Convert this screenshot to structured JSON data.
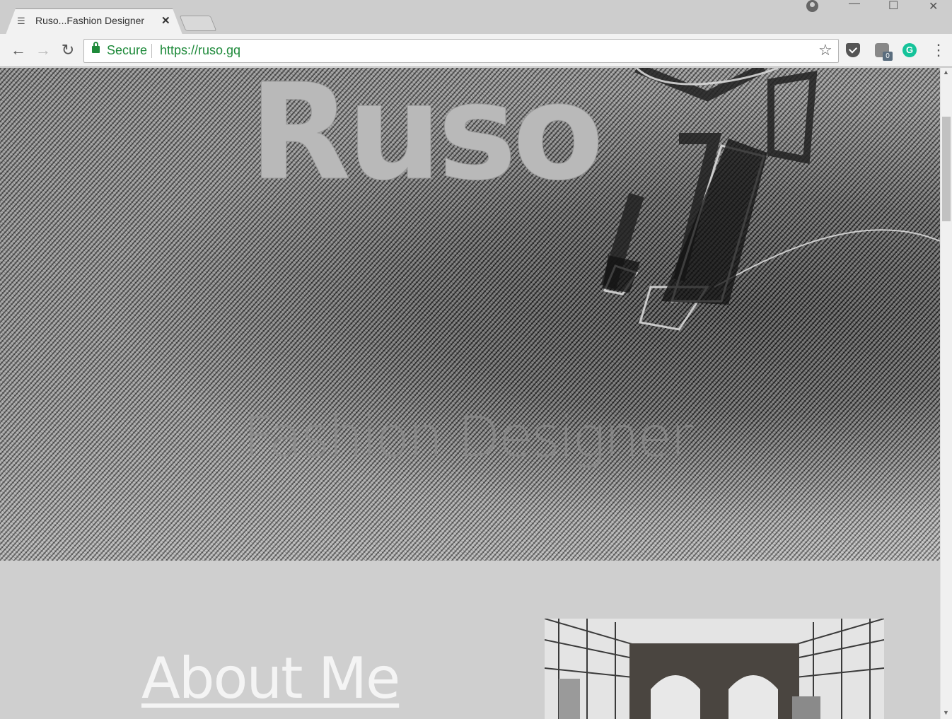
{
  "browser": {
    "tab": {
      "title": "Ruso...Fashion Designer",
      "favicon": "ruso-favicon",
      "close": "✕"
    },
    "window_controls": {
      "minimize": "—",
      "maximize": "☐",
      "close": "✕"
    },
    "nav": {
      "back": "←",
      "forward": "→",
      "reload": "↻"
    },
    "address": {
      "secure_label": "Secure",
      "url": "https://ruso.gq"
    },
    "extensions": {
      "bookmark": "☆",
      "grammarly": "G",
      "badge_count": "0",
      "menu": "⋮"
    }
  },
  "page": {
    "hero": {
      "title": "Ruso",
      "subtitle": "Fashion Designer"
    },
    "about": {
      "heading": "About Me"
    }
  },
  "scrollbar": {
    "up": "▲",
    "down": "▼"
  },
  "colors": {
    "secure_green": "#1e8a3a",
    "grammarly": "#15c39a",
    "page_bg": "#cfcfcf"
  }
}
